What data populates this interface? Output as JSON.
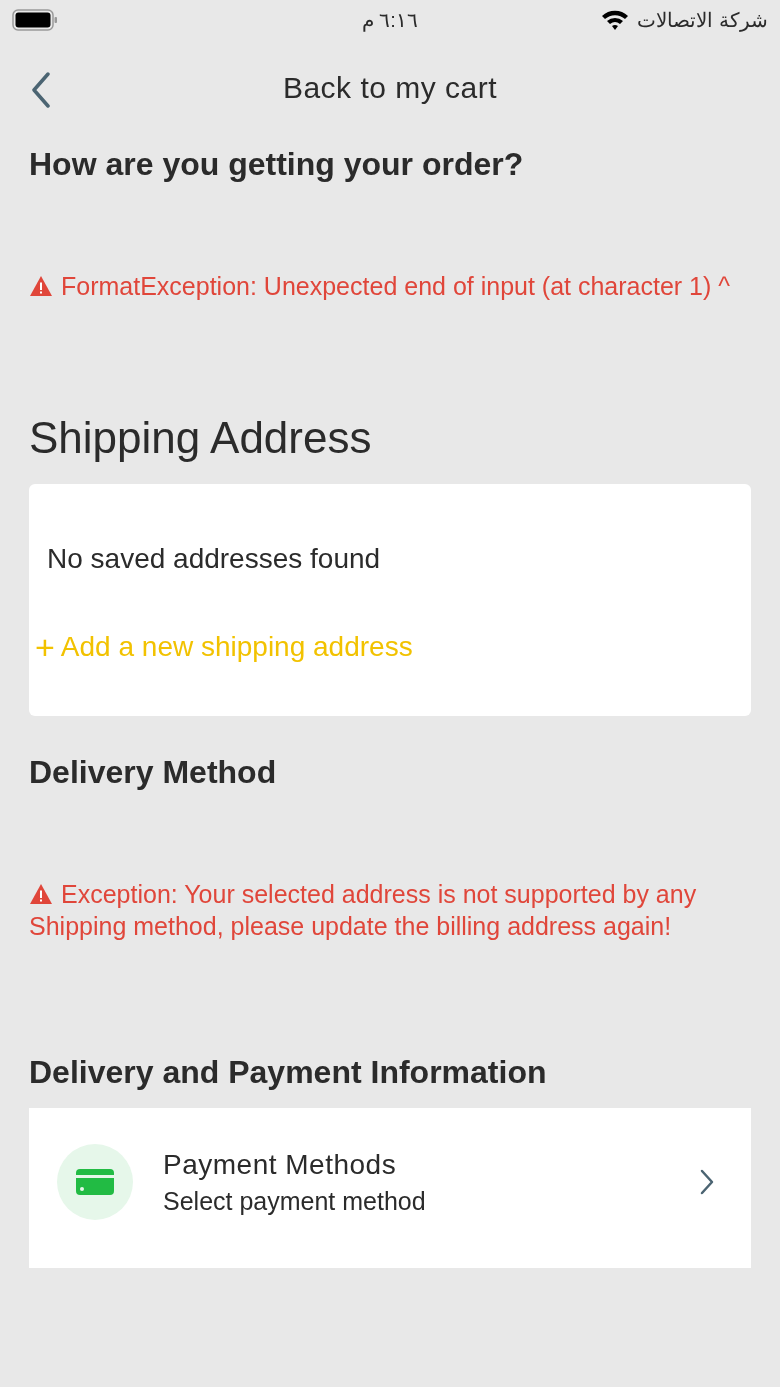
{
  "status_bar": {
    "time": "٦:١٦ م",
    "carrier": "شركة الاتصالات"
  },
  "header": {
    "title": "Back to my cart"
  },
  "sections": [
    {
      "kind": "error_section",
      "title": "How are you getting your order?",
      "error": "FormatException: Unexpected end of input (at character 1) ^"
    },
    {
      "kind": "address_section",
      "title": "Shipping Address",
      "empty_text": "No saved addresses found",
      "add_link": "Add a new shipping address",
      "add_icon": "+"
    },
    {
      "kind": "error_section",
      "title": "Delivery Method",
      "error": "Exception: Your selected address is not supported by any Shipping method, please update the billing address again!"
    },
    {
      "kind": "payment_section",
      "title": "Delivery and Payment Information",
      "item": {
        "title": "Payment Methods",
        "subtitle": "Select payment method"
      }
    }
  ]
}
